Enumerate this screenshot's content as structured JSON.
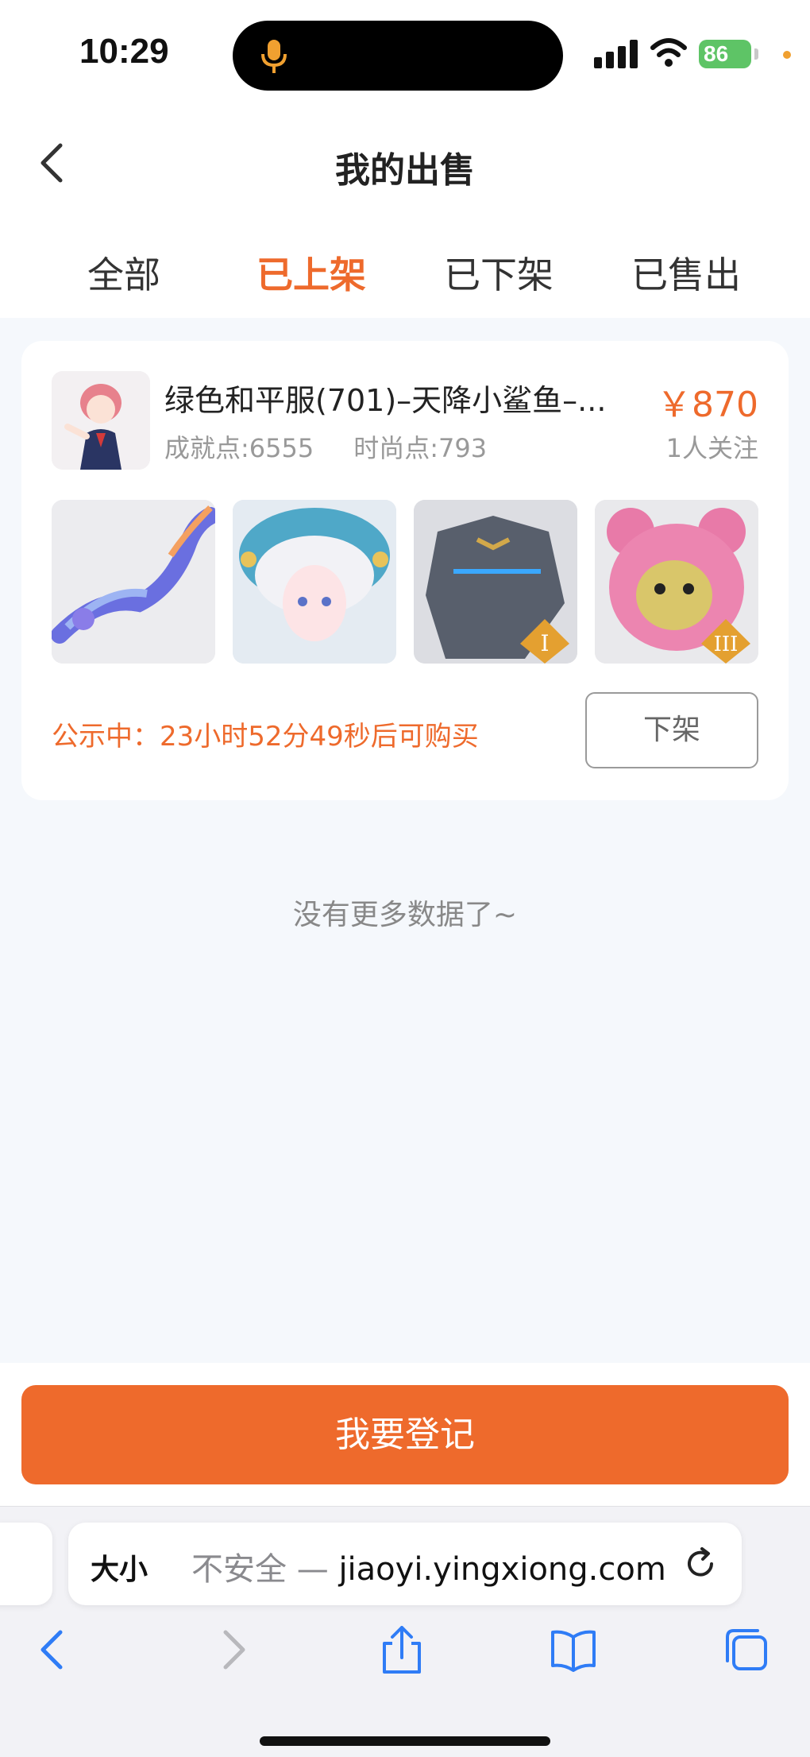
{
  "status_bar": {
    "time": "10:29",
    "battery": "86"
  },
  "nav": {
    "title": "我的出售"
  },
  "tabs": [
    {
      "label": "全部",
      "active": false
    },
    {
      "label": "已上架",
      "active": true
    },
    {
      "label": "已下架",
      "active": false
    },
    {
      "label": "已售出",
      "active": false
    }
  ],
  "listing": {
    "title": "绿色和平服(701)–天降小鲨鱼–...",
    "price": "￥870",
    "achievement": "成就点:6555",
    "fashion": "时尚点:793",
    "followers": "1人关注",
    "notice": "公示中：23小时52分49秒后可购买",
    "delist_label": "下架"
  },
  "footer_text": "没有更多数据了~",
  "register_label": "我要登记",
  "browser": {
    "aa_label": "大小",
    "url_prefix": "不安全 — ",
    "url_domain": "jiaoyi.yingxiong.com"
  },
  "colors": {
    "accent": "#ee6a2c",
    "background": "#f5f8fc",
    "battery": "#5ec466"
  }
}
